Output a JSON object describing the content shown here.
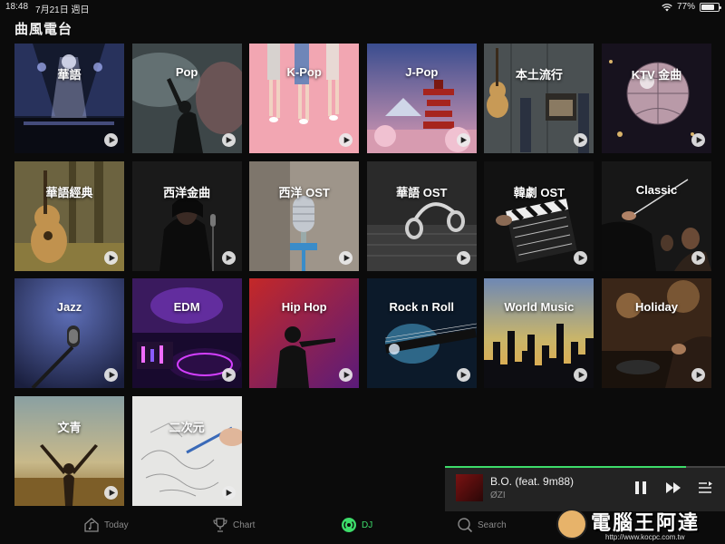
{
  "status": {
    "time": "18:48",
    "date": "7月21日 週日",
    "battery_text": "77%",
    "battery_level": 0.77
  },
  "page": {
    "title": "曲風電台"
  },
  "tiles": [
    {
      "label": "華語"
    },
    {
      "label": "Pop"
    },
    {
      "label": "K-Pop"
    },
    {
      "label": "J-Pop"
    },
    {
      "label": "本土流行"
    },
    {
      "label": "KTV 金曲"
    },
    {
      "label": "華語經典"
    },
    {
      "label": "西洋金曲"
    },
    {
      "label": "西洋 OST"
    },
    {
      "label": "華語 OST"
    },
    {
      "label": "韓劇 OST"
    },
    {
      "label": "Classic"
    },
    {
      "label": "Jazz"
    },
    {
      "label": "EDM"
    },
    {
      "label": "Hip Hop"
    },
    {
      "label": "Rock n Roll"
    },
    {
      "label": "World Music"
    },
    {
      "label": "Holiday"
    },
    {
      "label": "文青"
    },
    {
      "label": "二次元"
    }
  ],
  "player": {
    "title": "B.O. (feat. 9m88)",
    "artist": "ØZI",
    "progress": 0.86
  },
  "tabs": [
    {
      "label": "Today",
      "icon": "house-music-icon"
    },
    {
      "label": "Chart",
      "icon": "trophy-icon"
    },
    {
      "label": "DJ",
      "icon": "radio-icon"
    },
    {
      "label": "Search",
      "icon": "search-icon"
    }
  ],
  "watermark": {
    "text": "電腦王阿達",
    "url": "http://www.kocpc.com.tw"
  },
  "colors": {
    "accent": "#3ddc6a",
    "background": "#0b0b0b",
    "player_bg": "#232323"
  }
}
